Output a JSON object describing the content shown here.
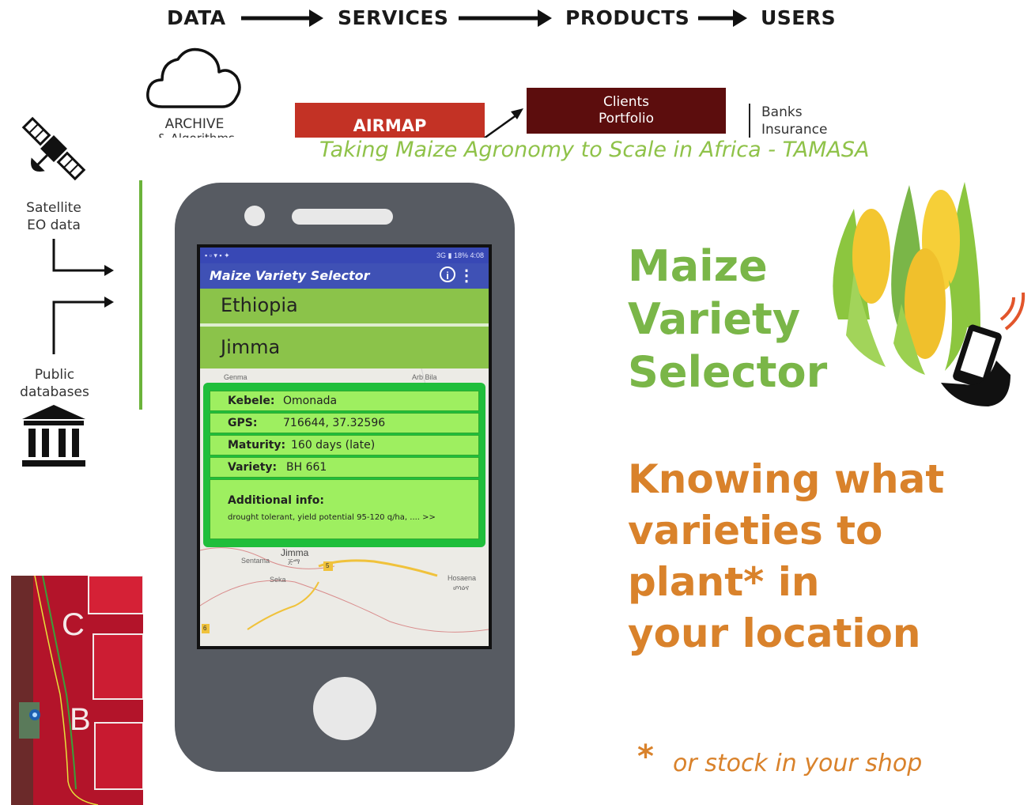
{
  "flow": {
    "data": "DATA",
    "services": "SERVICES",
    "products": "PRODUCTS",
    "users": "USERS"
  },
  "archive": {
    "label": "ARCHIVE",
    "cut_label": "& Algorithms"
  },
  "airmap": "AIRMAP",
  "clients": {
    "line1": "Clients",
    "line2": "Portfolio"
  },
  "users_list": {
    "line1": "Banks",
    "line2": "Insurance"
  },
  "tamasa_title": "Taking Maize Agronomy to Scale in Africa - TAMASA",
  "sources": {
    "satellite_line1": "Satellite",
    "satellite_line2": "EO data",
    "public_line1": "Public",
    "public_line2": "databases"
  },
  "app": {
    "status_left": "▪ ▫ ▾ ▪ ✦",
    "status_right": "3G ▮ 18% 4:08",
    "title": "Maize Variety Selector",
    "info_icon": "i",
    "more_icon": "⋮",
    "country": "Ethiopia",
    "region": "Jimma",
    "map_labels": {
      "top_left": "Genma",
      "top_right": "Arb Bila",
      "jimma": "Jimma",
      "sentama": "Sentama",
      "seka": "Seka",
      "hosaena": "Hosaena",
      "jimma_script": "ጅማ",
      "hosaena_script": "ሆሳዕና",
      "road_5": "5",
      "road_6": "6"
    },
    "card": {
      "kebele_label": "Kebele:",
      "kebele_value": "Omonada",
      "gps_label": "GPS:",
      "gps_value": "716644, 37.32596",
      "maturity_label": "Maturity:",
      "maturity_value": "160 days (late)",
      "variety_label": "Variety:",
      "variety_value": "BH 661",
      "additional_label": "Additional info:",
      "additional_value": "drought tolerant, yield potential 95-120 q/ha, .... >>"
    }
  },
  "maize_title": {
    "line1": "Maize",
    "line2": "Variety",
    "line3": "Selector"
  },
  "knowing": {
    "line1": "Knowing what",
    "line2": "varieties to",
    "line3": "plant* in",
    "line4": "your location"
  },
  "asterisk": "*",
  "footnote": "or stock in your shop",
  "sat_image": {
    "label_c": "C",
    "label_b": "B"
  },
  "colors": {
    "green_accent": "#7ab648",
    "orange_accent": "#d9822b",
    "airmap_red": "#c33225",
    "clients_maroon": "#5c0d0d",
    "app_blue": "#3f51b5",
    "row_green": "#8bc34a"
  }
}
